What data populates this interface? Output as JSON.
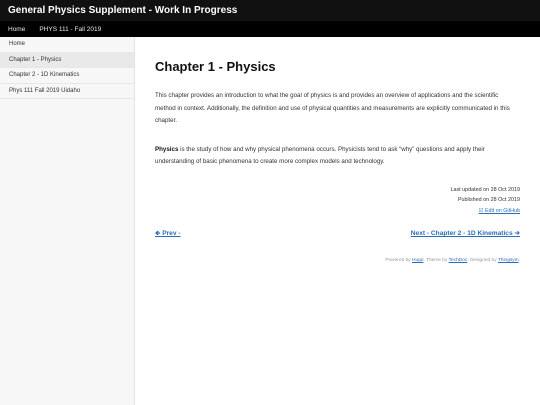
{
  "header": {
    "title": "General Physics Supplement - Work In Progress"
  },
  "nav": {
    "items": [
      "Home",
      "PHYS 111 - Fall 2019"
    ]
  },
  "sidebar": {
    "items": [
      {
        "label": "Home",
        "active": false
      },
      {
        "label": "Chapter 1 - Physics",
        "active": true
      },
      {
        "label": "Chapter 2 - 1D Kinematics",
        "active": false
      },
      {
        "label": "Phys 111 Fall 2019 Uidaho",
        "active": false
      }
    ]
  },
  "main": {
    "title": "Chapter 1 - Physics",
    "intro": "This chapter provides an introduction to what the goal of physics is and provides an overview of applications and the scientific method in context. Additionally, the definition and use of physical quantities and measurements are explicitly communicated in this chapter.",
    "physics_term": "Physics",
    "physics_def": " is the study of how and why physical phenomena occurs. Physicists tend to ask “why” questions and apply their understanding of basic phenomena to create more complex models and technology."
  },
  "meta": {
    "last_updated": "Last updated on 28 Oct 2019",
    "published": "Published on 28 Oct 2019",
    "edit_label": "Edit on GitHub",
    "edit_icon": "☑"
  },
  "pager": {
    "prev_icon": "🡸",
    "prev_label": " Prev -",
    "next_label": "Next - Chapter 2 - 1D Kinematics ",
    "next_icon": "➔"
  },
  "footer": {
    "powered": "Powered by ",
    "hugo": "Hugo",
    "theme": ". Theme by ",
    "techdoc": "TechDoc",
    "designed": ". Designed by ",
    "thingsym": "Thingsym",
    "end": "."
  },
  "colors": {
    "accent": "#2a6ebb",
    "topbar": "#111111",
    "navbar": "#000000"
  }
}
